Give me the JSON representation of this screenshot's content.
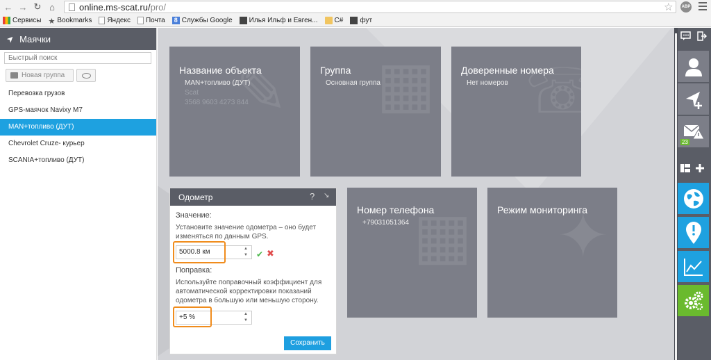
{
  "browser": {
    "url_host": "online.ms-scat.ru/",
    "url_path": "pro/",
    "ext_badge": "ABP"
  },
  "bookmarks": [
    {
      "label": "Сервисы",
      "icon": "apps-grid-icon"
    },
    {
      "label": "Bookmarks",
      "icon": "star-icon"
    },
    {
      "label": "Яндекс",
      "icon": "page-icon"
    },
    {
      "label": "Почта",
      "icon": "page-icon"
    },
    {
      "label": "Службы Google",
      "icon": "google-icon"
    },
    {
      "label": "Илья Ильф и Евген...",
      "icon": "page-icon"
    },
    {
      "label": "C#",
      "icon": "folder-icon"
    },
    {
      "label": "фут",
      "icon": "page-icon"
    }
  ],
  "sidebar": {
    "title": "Маячки",
    "search_placeholder": "Быстрый поиск",
    "new_group_label": "Новая группа",
    "trackers": [
      {
        "label": "Перевозка грузов",
        "active": false
      },
      {
        "label": "GPS-маячок Navixy M7",
        "active": false
      },
      {
        "label": "MAN+топливо (ДУТ)",
        "active": true
      },
      {
        "label": "Chevrolet Cruze- курьер",
        "active": false
      },
      {
        "label": "SCANIA+топливо (ДУТ)",
        "active": false
      }
    ]
  },
  "tiles": {
    "object": {
      "title": "Название объекта",
      "name": "MAN+топливо (ДУТ)",
      "model": "Scat",
      "id": "3568 9603 4273 844"
    },
    "group": {
      "title": "Группа",
      "value": "Основная группа"
    },
    "trusted": {
      "title": "Доверенные номера",
      "value": "Нет номеров"
    },
    "phone": {
      "title": "Номер телефона",
      "value": "+79031051364"
    },
    "monitoring": {
      "title": "Режим мониторинга"
    }
  },
  "odometer": {
    "title": "Одометр",
    "help": "?",
    "value_label": "Значение:",
    "value_hint": "Установите значение одометра – оно будет изменяться по данным GPS.",
    "value": "5000.8  км",
    "correction_label": "Поправка:",
    "correction_hint": "Используйте поправочный коэффициент для автоматической корректировки показаний одометра в большую или меньшую сторону.",
    "correction": "+5  %",
    "save_label": "Сохранить"
  },
  "rail": {
    "alert_count": "23"
  },
  "colors": {
    "accent_blue": "#1ea1e0",
    "accent_green": "#6aba2e",
    "highlight_orange": "#f08c1c",
    "tile_gray": "#7c7e88",
    "header_dark": "#5a5d66"
  }
}
